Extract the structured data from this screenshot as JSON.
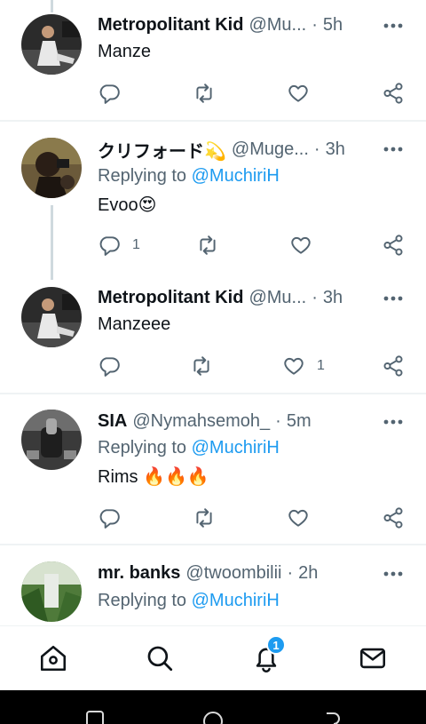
{
  "tweets": [
    {
      "name": "Metropolitant Kid",
      "handle": "@Mu...",
      "time": "5h",
      "text": "Manze",
      "replies": "",
      "likes": ""
    },
    {
      "name": "クリフォード💫",
      "handle": "@Muge...",
      "time": "3h",
      "replying_prefix": "Replying to",
      "replying_to": "@MuchiriH",
      "text": "Evoo😍",
      "replies": "1",
      "likes": ""
    },
    {
      "name": "Metropolitant Kid",
      "handle": "@Mu...",
      "time": "3h",
      "text": "Manzeee",
      "replies": "",
      "likes": "1"
    },
    {
      "name": "SIA",
      "handle": "@Nymahsemoh_",
      "time": "5m",
      "replying_prefix": "Replying to",
      "replying_to": "@MuchiriH",
      "text": "Rims 🔥🔥🔥",
      "replies": "",
      "likes": ""
    },
    {
      "name": "mr. banks",
      "handle": "@twoombilii",
      "time": "2h",
      "replying_prefix": "Replying to",
      "replying_to": "@MuchiriH",
      "text": ""
    }
  ],
  "bottom_nav": {
    "notification_badge": "1",
    "items": [
      "home-icon",
      "search-icon",
      "bell-icon",
      "mail-icon"
    ]
  },
  "colors": {
    "accent": "#1d9bf0",
    "text": "#0f1419",
    "secondary": "#536471",
    "divider": "#eff3f4"
  }
}
